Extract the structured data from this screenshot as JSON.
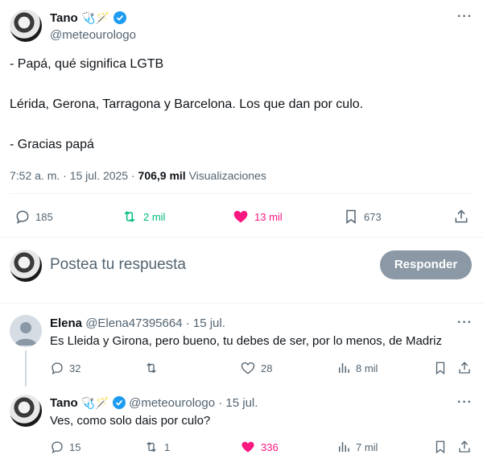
{
  "main_tweet": {
    "author": "Tano",
    "emoji": "🩺🪄",
    "handle": "@meteourologo",
    "lines": [
      "- Papá, qué significa LGTB",
      "Lérida, Gerona, Tarragona y Barcelona. Los que dan por culo.",
      "- Gracias papá"
    ],
    "timestamp": "7:52 a. m. · 15 jul. 2025 ·",
    "views_count": "706,9 mil",
    "views_label": "Visualizaciones",
    "replies": "185",
    "retweets": "2 mil",
    "likes": "13 mil",
    "bookmarks": "673"
  },
  "composer": {
    "placeholder": "Postea tu respuesta",
    "button": "Responder"
  },
  "replies": [
    {
      "author": "Elena",
      "handle": "@Elena47395664 · 15 jul.",
      "text": "Es Lleida y Girona, pero bueno, tu debes de ser, por lo menos, de Madriz",
      "replies": "32",
      "retweets": "",
      "likes": "28",
      "views": "8 mil"
    },
    {
      "author": "Tano",
      "emoji": "🩺🪄",
      "handle": "@meteourologo · 15 jul.",
      "text": "Ves, como solo dais por culo?",
      "replies": "15",
      "retweets": "1",
      "likes": "336",
      "views": "7 mil"
    }
  ],
  "colors": {
    "retweet": "#00ba7c",
    "like": "#f91880",
    "verified": "#1d9bf0",
    "muted": "#536471"
  }
}
